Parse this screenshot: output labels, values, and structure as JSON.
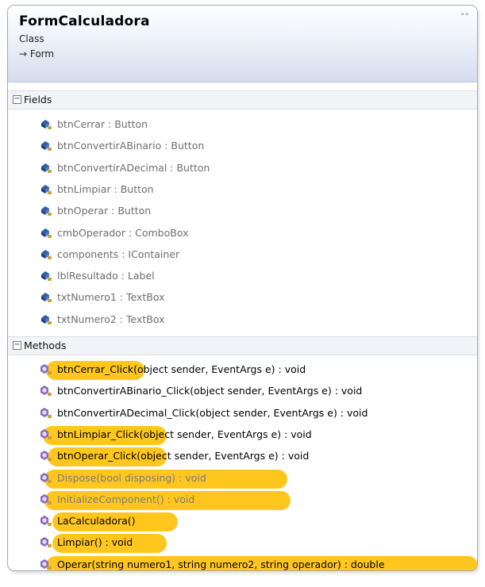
{
  "class_box": {
    "name": "FormCalculadora",
    "stereotype": "Class",
    "base": "→ Form",
    "collapse_glyph": "˄˄"
  },
  "fields_section": {
    "label": "Fields",
    "toggle": "−",
    "items": [
      {
        "label": "btnCerrar : Button",
        "icon": "field-icon"
      },
      {
        "label": "btnConvertirABinario : Button",
        "icon": "field-icon"
      },
      {
        "label": "btnConvertirADecimal : Button",
        "icon": "field-icon"
      },
      {
        "label": "btnLimpiar : Button",
        "icon": "field-icon"
      },
      {
        "label": "btnOperar : Button",
        "icon": "field-icon"
      },
      {
        "label": "cmbOperador : ComboBox",
        "icon": "field-icon"
      },
      {
        "label": "components : IContainer",
        "icon": "field-icon"
      },
      {
        "label": "lblResultado : Label",
        "icon": "field-icon"
      },
      {
        "label": "txtNumero1 : TextBox",
        "icon": "field-icon"
      },
      {
        "label": "txtNumero2 : TextBox",
        "icon": "field-icon"
      }
    ]
  },
  "methods_section": {
    "label": "Methods",
    "toggle": "−",
    "items": [
      {
        "label": "btnCerrar_Click(object sender, EventArgs e) : void",
        "icon": "method-icon",
        "highlighted": true
      },
      {
        "label": "btnConvertirABinario_Click(object sender, EventArgs e) : void",
        "icon": "method-icon",
        "highlighted": false
      },
      {
        "label": "btnConvertirADecimal_Click(object sender, EventArgs e) : void",
        "icon": "method-icon",
        "highlighted": false
      },
      {
        "label": "btnLimpiar_Click(object sender, EventArgs e) : void",
        "icon": "method-icon",
        "highlighted": true
      },
      {
        "label": "btnOperar_Click(object sender, EventArgs e) : void",
        "icon": "method-icon",
        "highlighted": true
      },
      {
        "label": "Dispose(bool disposing) : void",
        "icon": "method-icon",
        "highlighted": true
      },
      {
        "label": "InitializeComponent() : void",
        "icon": "method-icon",
        "highlighted": true
      },
      {
        "label": "LaCalculadora()",
        "icon": "method-icon",
        "highlighted": true
      },
      {
        "label": "Limpiar() : void",
        "icon": "method-icon",
        "highlighted": true
      },
      {
        "label": "Operar(string numero1, string numero2, string operador) : double",
        "icon": "method-icon",
        "highlighted": true
      }
    ]
  },
  "colors": {
    "highlight": "#ffc20a",
    "field_icon": "#2f5fa8",
    "method_icon": "#8a6bc0"
  }
}
